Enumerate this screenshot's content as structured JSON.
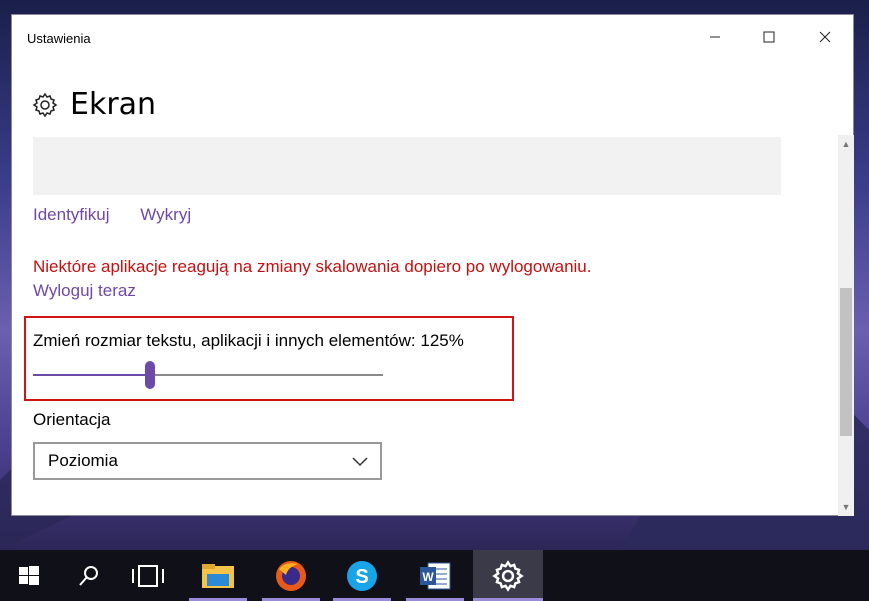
{
  "window": {
    "title": "Ustawienia",
    "minimize_label": "—",
    "maximize_label": "☐",
    "close_label": "✕"
  },
  "page": {
    "title": "Ekran",
    "header_icon": "gear-icon"
  },
  "display": {
    "identify_label": "Identyfikuj",
    "detect_label": "Wykryj",
    "warning_text": "Niektóre aplikacje reagują na zmiany skalowania dopiero po wylogowaniu.",
    "logout_label": "Wyloguj teraz",
    "scale_label": "Zmień rozmiar tekstu, aplikacji i innych elementów: 125%",
    "scale_slider_fraction": 0.333,
    "orientation_label": "Orientacja",
    "orientation_value": "Poziomia"
  },
  "colors": {
    "accent": "#6e4aa8",
    "link": "#7048a8",
    "warning": "#c41010",
    "highlight_border": "#d01414"
  },
  "taskbar": {
    "items": [
      {
        "name": "start-icon"
      },
      {
        "name": "search-icon"
      },
      {
        "name": "task-view-icon"
      },
      {
        "name": "file-explorer-icon"
      },
      {
        "name": "firefox-icon"
      },
      {
        "name": "skype-icon"
      },
      {
        "name": "word-icon"
      },
      {
        "name": "settings-icon"
      }
    ]
  }
}
